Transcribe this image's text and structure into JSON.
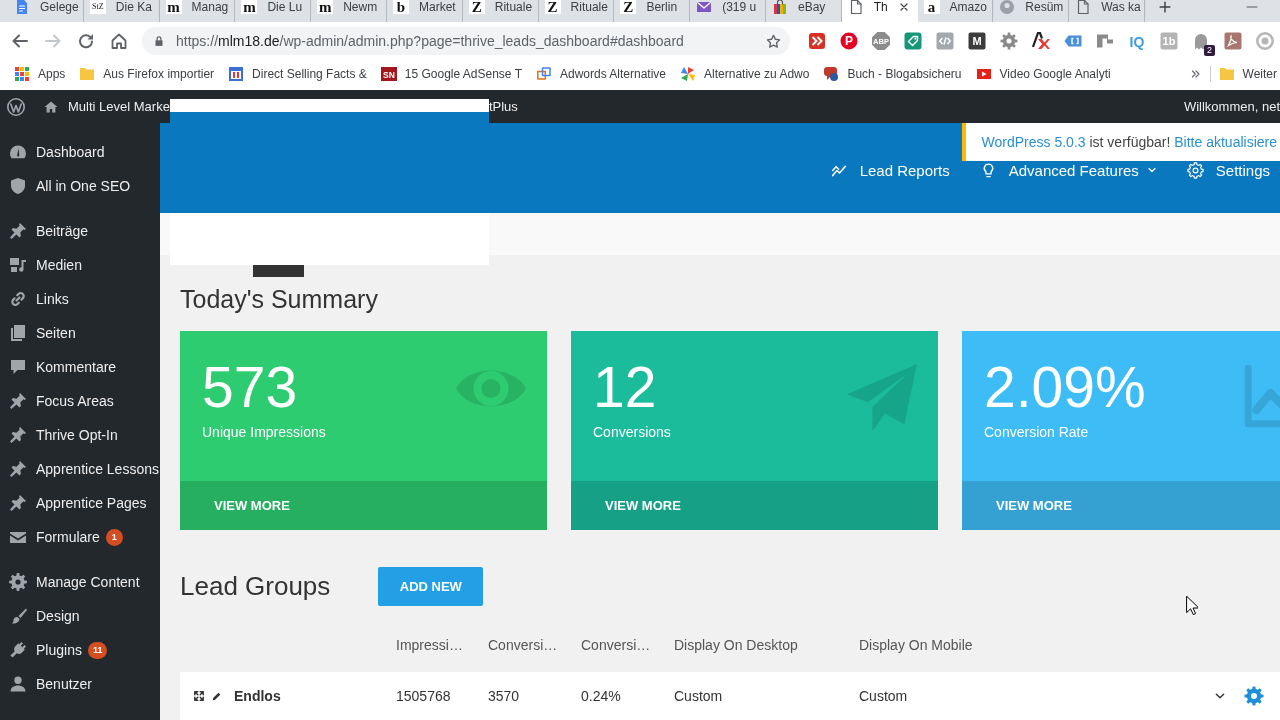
{
  "browser": {
    "tabs": [
      {
        "label": "Gelege",
        "kind": "docs",
        "selected": false
      },
      {
        "label": "Die Ka",
        "kind": "letters",
        "favicon_text": "StZ",
        "selected": false
      },
      {
        "label": "Manag",
        "kind": "letter",
        "favicon_text": "m",
        "selected": false
      },
      {
        "label": "Die Lu",
        "kind": "letter",
        "favicon_text": "m",
        "selected": false
      },
      {
        "label": "Newm",
        "kind": "letter",
        "favicon_text": "m",
        "selected": false
      },
      {
        "label": "Market",
        "kind": "letter",
        "favicon_text": "b",
        "selected": false
      },
      {
        "label": "Rituale",
        "kind": "letter",
        "favicon_text": "Z",
        "selected": false
      },
      {
        "label": "Rituale",
        "kind": "letter",
        "favicon_text": "Z",
        "selected": false
      },
      {
        "label": "Berlin",
        "kind": "letter",
        "favicon_text": "Z",
        "selected": false
      },
      {
        "label": "(319 u",
        "kind": "mail",
        "selected": false
      },
      {
        "label": "eBay",
        "kind": "shop",
        "selected": false
      },
      {
        "label": "Th",
        "kind": "page",
        "selected": true
      },
      {
        "label": "Amazo",
        "kind": "letter",
        "favicon_text": "a",
        "selected": false
      },
      {
        "label": "Resüm",
        "kind": "avatar",
        "selected": false
      },
      {
        "label": "Was ka",
        "kind": "page",
        "selected": false
      }
    ],
    "address": {
      "scheme": "https://",
      "host": "mlm18.de",
      "path": "/wp-admin/admin.php?page=thrive_leads_dashboard#dashboard"
    },
    "extensions": [
      {
        "kind": "forward",
        "color": "#d93025"
      },
      {
        "kind": "round",
        "color": "#e60023",
        "text": "P"
      },
      {
        "kind": "octagon",
        "color": "#8c8c8c",
        "text": "ABP"
      },
      {
        "kind": "tag",
        "color": "#16977a"
      },
      {
        "kind": "code",
        "color": "#a3a8ad"
      },
      {
        "kind": "tile",
        "color": "#3c3c3c",
        "text": "M"
      },
      {
        "kind": "gear",
        "color": "#8a8a8a"
      },
      {
        "kind": "cross",
        "color": "#e53935"
      },
      {
        "kind": "bracket",
        "color": "#4a8fdc"
      },
      {
        "kind": "steps",
        "color": "#8a8a8a"
      },
      {
        "kind": "mark",
        "color": "#3d9be0",
        "text": "IQ"
      },
      {
        "kind": "tile",
        "color": "#b4b4b4",
        "text": "1b"
      },
      {
        "kind": "ghost",
        "color": "#9a9a9a",
        "badge": "2"
      },
      {
        "kind": "pdf",
        "color": "#a8766e"
      },
      {
        "kind": "ring",
        "color": "#b5b5b5"
      }
    ],
    "bookmarks": [
      {
        "label": "Apps",
        "kind": "apps"
      },
      {
        "label": "Aus Firefox importier",
        "kind": "folder"
      },
      {
        "label": "Direct Selling Facts &",
        "kind": "calendar"
      },
      {
        "label": "15 Google AdSense T",
        "kind": "letters",
        "favicon_text": "SN"
      },
      {
        "label": "Adwords Alternative",
        "kind": "squares"
      },
      {
        "label": "Alternative zu Adwo",
        "kind": "pinwheel"
      },
      {
        "label": "Buch - Blogabsicheru",
        "kind": "bubble"
      },
      {
        "label": "Video Google Analyti",
        "kind": "play"
      }
    ],
    "other_bookmarks": {
      "label": "Weiter",
      "kind": "folder"
    }
  },
  "admin_bar": {
    "site_title": "Multi Level Marke",
    "site_title_end": "tPlus",
    "greeting": "Willkommen, net"
  },
  "sidebar": {
    "sections": [
      {
        "items": [
          {
            "label": "Dashboard",
            "kind": "gauge"
          },
          {
            "label": "All in One SEO",
            "kind": "shield"
          }
        ]
      },
      {
        "items": [
          {
            "label": "Beiträge",
            "kind": "pin"
          },
          {
            "label": "Medien",
            "kind": "media"
          },
          {
            "label": "Links",
            "kind": "link"
          },
          {
            "label": "Seiten",
            "kind": "pages"
          },
          {
            "label": "Kommentare",
            "kind": "comment"
          },
          {
            "label": "Focus Areas",
            "kind": "pin"
          },
          {
            "label": "Thrive Opt-In",
            "kind": "pin"
          },
          {
            "label": "Apprentice Lessons",
            "kind": "pin"
          },
          {
            "label": "Apprentice Pages",
            "kind": "pin"
          },
          {
            "label": "Formulare",
            "kind": "mail",
            "badge": "1"
          }
        ]
      },
      {
        "items": [
          {
            "label": "Manage Content",
            "kind": "gear"
          },
          {
            "label": "Design",
            "kind": "brush"
          },
          {
            "label": "Plugins",
            "kind": "plug",
            "badge": "11"
          },
          {
            "label": "Benutzer",
            "kind": "user"
          }
        ]
      }
    ]
  },
  "header": {
    "nav": [
      {
        "label": "Lead Reports",
        "kind": "chart",
        "dropdown": false
      },
      {
        "label": "Advanced Features",
        "kind": "bulb",
        "dropdown": true
      },
      {
        "label": "Settings",
        "kind": "gear",
        "dropdown": false
      }
    ],
    "notice": {
      "version_link": "WordPress 5.0.3",
      "text": "ist verfügbar!",
      "update_link": "Bitte aktualisiere"
    }
  },
  "summary": {
    "title": "Today's Summary",
    "cards": [
      {
        "value": "573",
        "label": "Unique Impressions",
        "action": "VIEW MORE",
        "kind": "eye",
        "color": "#2ecc71"
      },
      {
        "value": "12",
        "label": "Conversions",
        "action": "VIEW MORE",
        "kind": "plane",
        "color": "#1abc9c"
      },
      {
        "value": "2.09%",
        "label": "Conversion Rate",
        "action": "VIEW MORE",
        "kind": "chart",
        "color": "#3ebcf6"
      }
    ]
  },
  "lead_groups": {
    "title": "Lead Groups",
    "add_button": "ADD NEW",
    "columns": [
      "Impressi…",
      "Conversi…",
      "Conversi…",
      "Display On Desktop",
      "Display On Mobile"
    ],
    "rows": [
      {
        "name": "Endlos",
        "cells": [
          "1505768",
          "3570",
          "0.24%",
          "Custom",
          "Custom"
        ]
      }
    ]
  }
}
